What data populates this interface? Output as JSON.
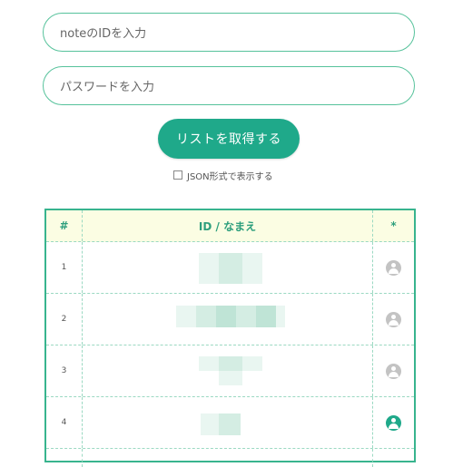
{
  "form": {
    "id_placeholder": "noteのIDを入力",
    "password_placeholder": "パスワードを入力",
    "submit_label": "リストを取得する",
    "json_option_label": "JSON形式で表示する",
    "json_option_checked": false
  },
  "table": {
    "headers": {
      "num": "#",
      "name": "ID / なまえ",
      "star": "*"
    },
    "rows": [
      {
        "num": "1",
        "avatar_active": false
      },
      {
        "num": "2",
        "avatar_active": false
      },
      {
        "num": "3",
        "avatar_active": false
      },
      {
        "num": "4",
        "avatar_active": true
      }
    ]
  },
  "colors": {
    "accent": "#1fa98a",
    "border": "#56c29b",
    "header_bg": "#fbfde3",
    "avatar_inactive": "#c3c3c3"
  }
}
